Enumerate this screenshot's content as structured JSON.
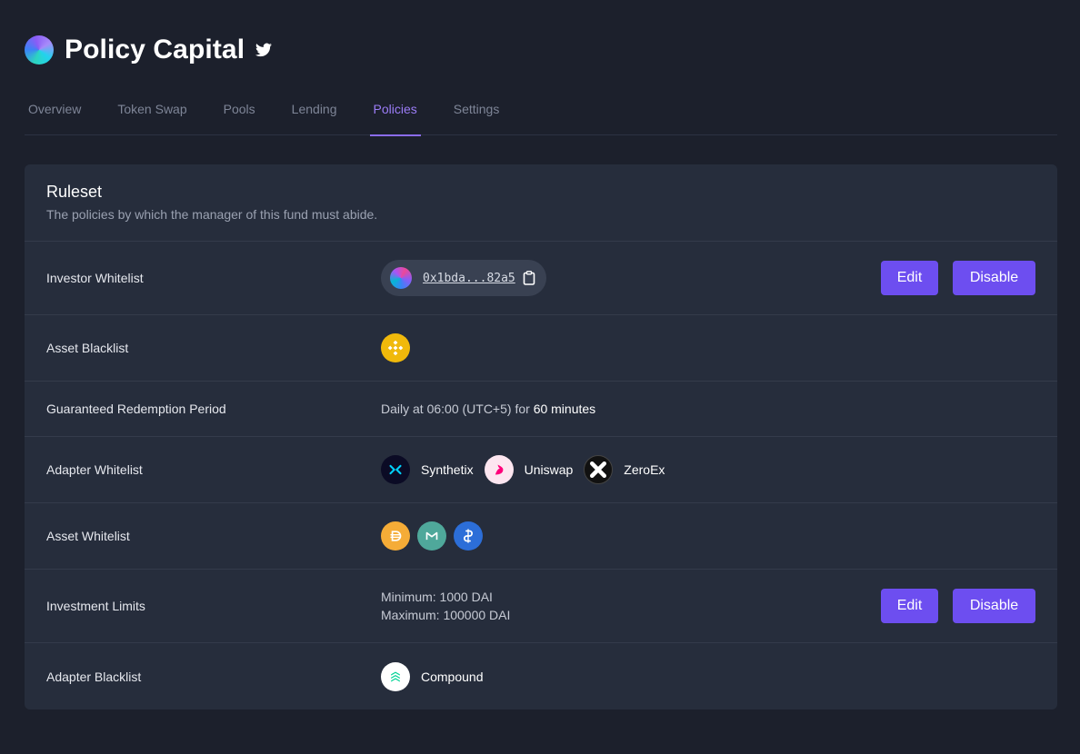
{
  "header": {
    "title": "Policy Capital"
  },
  "tabs": [
    {
      "label": "Overview"
    },
    {
      "label": "Token Swap"
    },
    {
      "label": "Pools"
    },
    {
      "label": "Lending"
    },
    {
      "label": "Policies",
      "active": true
    },
    {
      "label": "Settings"
    }
  ],
  "ruleset": {
    "title": "Ruleset",
    "subtitle": "The policies by which the manager of this fund must abide."
  },
  "buttons": {
    "edit": "Edit",
    "disable": "Disable"
  },
  "rows": {
    "investor_whitelist": {
      "label": "Investor Whitelist",
      "address": "0x1bda...82a5"
    },
    "asset_blacklist": {
      "label": "Asset Blacklist",
      "tokens": [
        "binance-icon"
      ]
    },
    "redemption": {
      "label": "Guaranteed Redemption Period",
      "prefix": "Daily at 06:00 (UTC+5) for",
      "duration": "60 minutes"
    },
    "adapter_whitelist": {
      "label": "Adapter Whitelist",
      "adapters": [
        {
          "name": "Synthetix",
          "icon": "synthetix-icon"
        },
        {
          "name": "Uniswap",
          "icon": "uniswap-icon"
        },
        {
          "name": "ZeroEx",
          "icon": "zeroex-icon"
        }
      ]
    },
    "asset_whitelist": {
      "label": "Asset Whitelist",
      "tokens": [
        "dai-icon",
        "mkr-icon",
        "chain-icon"
      ]
    },
    "investment_limits": {
      "label": "Investment Limits",
      "minimum": "Minimum: 1000 DAI",
      "maximum": "Maximum: 100000 DAI"
    },
    "adapter_blacklist": {
      "label": "Adapter Blacklist",
      "adapters": [
        {
          "name": "Compound",
          "icon": "compound-icon"
        }
      ]
    }
  },
  "colors": {
    "accent": "#6d4ef0",
    "active_tab": "#9b7cf6",
    "background": "#1c202c",
    "card": "#262d3c"
  }
}
